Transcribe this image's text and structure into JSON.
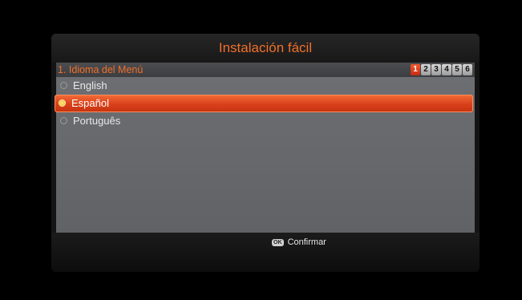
{
  "header": {
    "title": "Instalación fácil"
  },
  "step": {
    "title": "1. Idioma del Menú",
    "indicators": [
      "1",
      "2",
      "3",
      "4",
      "5",
      "6"
    ],
    "active_index": 0
  },
  "options": [
    {
      "label": "English",
      "selected": false
    },
    {
      "label": "Español",
      "selected": true
    },
    {
      "label": "Português",
      "selected": false
    }
  ],
  "footer": {
    "ok_icon_label": "OK",
    "confirm_label": "Confirmar"
  },
  "colors": {
    "accent": "#f0702a",
    "selection": "#d9401b",
    "active_step": "#e23d1d"
  }
}
